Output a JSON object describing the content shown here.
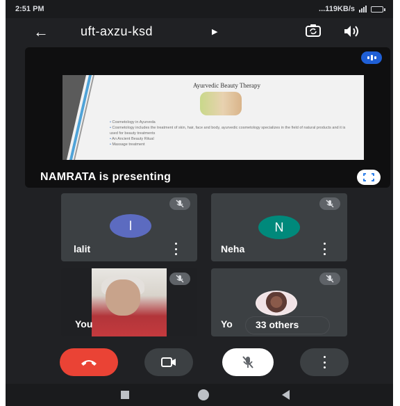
{
  "status_bar": {
    "time": "2:51 PM",
    "network_speed": "...119KB/s",
    "battery_icon": "battery-icon",
    "signal_icon": "signal-icon"
  },
  "top_bar": {
    "back_icon": "back-arrow-icon",
    "meeting_code": "uft-axzu-ksd",
    "caret_icon": "caret-right-icon",
    "switch_camera_icon": "switch-camera-icon",
    "speaker_icon": "speaker-icon"
  },
  "presentation": {
    "slide_title": "Ayurvedic Beauty Therapy",
    "slide_bullets": [
      "Cosmetology in Ayurveda",
      "Cosmetology includes the treatment of skin, hair, face and body, ayurvedic cosmetology specializes in the field of natural products and it is used for beauty treatments",
      "An Ancient Beauty Ritual",
      "Massage treatment"
    ],
    "presenting_label": "NAMRATA is presenting",
    "audio_icon": "audio-level-icon",
    "fullscreen_icon": "fullscreen-icon"
  },
  "participants": [
    {
      "name": "lalit",
      "initial": "l",
      "avatar_color": "#5c6bc0",
      "muted": true
    },
    {
      "name": "Neha",
      "initial": "N",
      "avatar_color": "#00897b",
      "muted": true
    },
    {
      "name": "You",
      "muted": true,
      "video": true
    },
    {
      "name": "Yo",
      "muted": true,
      "others_label": "33 others"
    }
  ],
  "controls": {
    "end_call_icon": "end-call-icon",
    "camera_icon": "video-camera-icon",
    "mic_icon": "mic-off-icon",
    "more_icon": "more-options-icon",
    "colors": {
      "end": "#ea4335",
      "secondary": "#3c4043",
      "mic": "#ffffff"
    }
  },
  "nav_bar": {
    "recents_icon": "recents-icon",
    "home_icon": "home-icon",
    "back_icon": "nav-back-icon"
  }
}
